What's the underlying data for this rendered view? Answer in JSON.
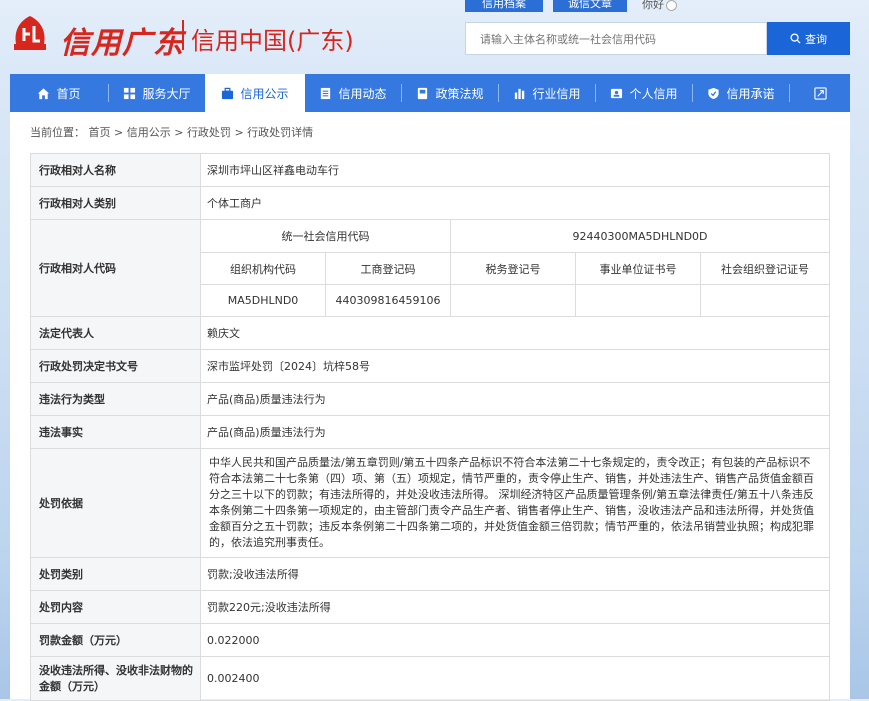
{
  "top_tabs": {
    "tab_a": "信用档案",
    "tab_b": "诚信文章",
    "tab_c": "你好"
  },
  "logo": {
    "script": "信用广东",
    "title": "信用中国(广东)"
  },
  "search": {
    "placeholder": "请输入主体名称或统一社会信用代码",
    "button_label": "查询",
    "button_icon": "search-icon"
  },
  "nav": {
    "items": [
      {
        "label": "首页",
        "icon": "home-icon"
      },
      {
        "label": "服务大厅",
        "icon": "grid-icon"
      },
      {
        "label": "信用公示",
        "icon": "briefcase-icon",
        "active": true
      },
      {
        "label": "信用动态",
        "icon": "document-icon"
      },
      {
        "label": "政策法规",
        "icon": "book-icon"
      },
      {
        "label": "行业信用",
        "icon": "bar-chart-icon"
      },
      {
        "label": "个人信用",
        "icon": "id-card-icon"
      },
      {
        "label": "信用承诺",
        "icon": "shield-icon"
      }
    ],
    "expand_icon": "expand-icon"
  },
  "breadcrumb": {
    "prefix": "当前位置：",
    "items": [
      "首页",
      "信用公示",
      "行政处罚",
      "行政处罚详情"
    ],
    "separator": ">"
  },
  "detail": {
    "rows": {
      "name": {
        "label": "行政相对人名称",
        "value": "深圳市坪山区祥鑫电动车行"
      },
      "category": {
        "label": "行政相对人类别",
        "value": "个体工商户"
      },
      "codes": {
        "label": "行政相对人代码",
        "uscc_label": "统一社会信用代码",
        "uscc_value": "92440300MA5DHLND0D",
        "headers": [
          "组织机构代码",
          "工商登记码",
          "税务登记号",
          "事业单位证书号",
          "社会组织登记证号"
        ],
        "values": [
          "MA5DHLND0",
          "440309816459106",
          "",
          "",
          ""
        ]
      },
      "legal_rep": {
        "label": "法定代表人",
        "value": "赖庆文"
      },
      "doc_no": {
        "label": "行政处罚决定书文号",
        "value": "深市监坪处罚〔2024〕坑梓58号"
      },
      "violation_type": {
        "label": "违法行为类型",
        "value": "产品(商品)质量违法行为"
      },
      "violation_facts": {
        "label": "违法事实",
        "value": "产品(商品)质量违法行为"
      },
      "basis": {
        "label": "处罚依据",
        "value": "中华人民共和国产品质量法/第五章罚则/第五十四条产品标识不符合本法第二十七条规定的，责令改正；有包装的产品标识不符合本法第二十七条第（四）项、第（五）项规定，情节严重的，责令停止生产、销售，并处违法生产、销售产品货值金额百分之三十以下的罚款；有违法所得的，并处没收违法所得。 深圳经济特区产品质量管理条例/第五章法律责任/第五十八条违反本条例第二十四条第一项规定的，由主管部门责令产品生产者、销售者停止生产、销售，没收违法产品和违法所得，并处货值金额百分之五十罚款；违反本条例第二十四条第二项的，并处货值金额三倍罚款；情节严重的，依法吊销营业执照；构成犯罪的，依法追究刑事责任。"
      },
      "penalty_type": {
        "label": "处罚类别",
        "value": "罚款;没收违法所得"
      },
      "penalty_content": {
        "label": "处罚内容",
        "value": "罚款220元;没收违法所得"
      },
      "fine_amount": {
        "label": "罚款金额（万元）",
        "value": "0.022000"
      },
      "confiscation_amount": {
        "label": "没收违法所得、没收非法财物的金额（万元）",
        "value": "0.002400"
      }
    }
  },
  "colors": {
    "brand_red": "#d7261e",
    "nav_blue": "#3478e0",
    "button_blue": "#1a66d9"
  }
}
